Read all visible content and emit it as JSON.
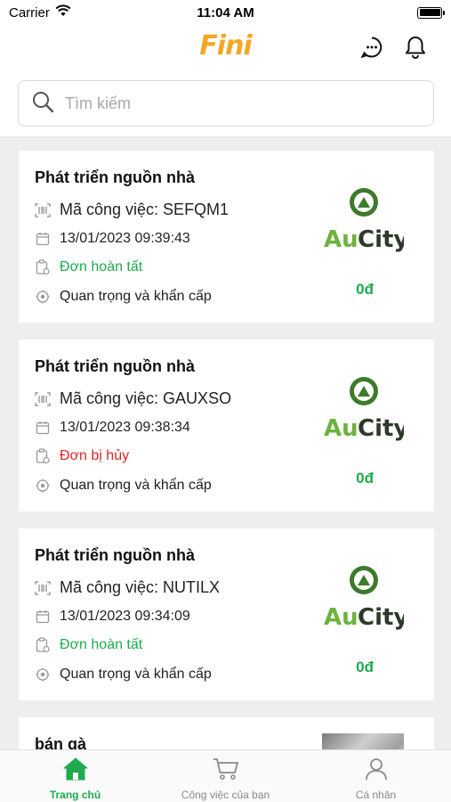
{
  "status_bar": {
    "carrier": "Carrier",
    "time": "11:04 AM"
  },
  "header": {
    "logo": "Fini"
  },
  "search": {
    "placeholder": "Tìm kiếm"
  },
  "colors": {
    "green": "#1eab4f",
    "red": "#e02424",
    "brand_orange": "#f5a623"
  },
  "cards": [
    {
      "title": "Phát triển nguồn nhà",
      "code_label": "Mã công việc: SEFQM1",
      "datetime": "13/01/2023 09:39:43",
      "status": "Đơn hoàn tất",
      "status_type": "done",
      "priority": "Quan trọng và khẩn cấp",
      "brand": "AuCity",
      "price": "0đ"
    },
    {
      "title": "Phát triển nguồn nhà",
      "code_label": "Mã công việc: GAUXSO",
      "datetime": "13/01/2023 09:38:34",
      "status": "Đơn bị hủy",
      "status_type": "cancel",
      "priority": "Quan trọng và khẩn cấp",
      "brand": "AuCity",
      "price": "0đ"
    },
    {
      "title": "Phát triển nguồn nhà",
      "code_label": "Mã công việc: NUTILX",
      "datetime": "13/01/2023 09:34:09",
      "status": "Đơn hoàn tất",
      "status_type": "done",
      "priority": "Quan trọng và khẩn cấp",
      "brand": "AuCity",
      "price": "0đ"
    },
    {
      "title": "bán gà"
    }
  ],
  "tabs": [
    {
      "label": "Trang chủ",
      "icon": "home-icon",
      "active": true
    },
    {
      "label": "Công việc của bạn",
      "icon": "cart-icon",
      "active": false
    },
    {
      "label": "Cá nhân",
      "icon": "user-icon",
      "active": false
    }
  ]
}
